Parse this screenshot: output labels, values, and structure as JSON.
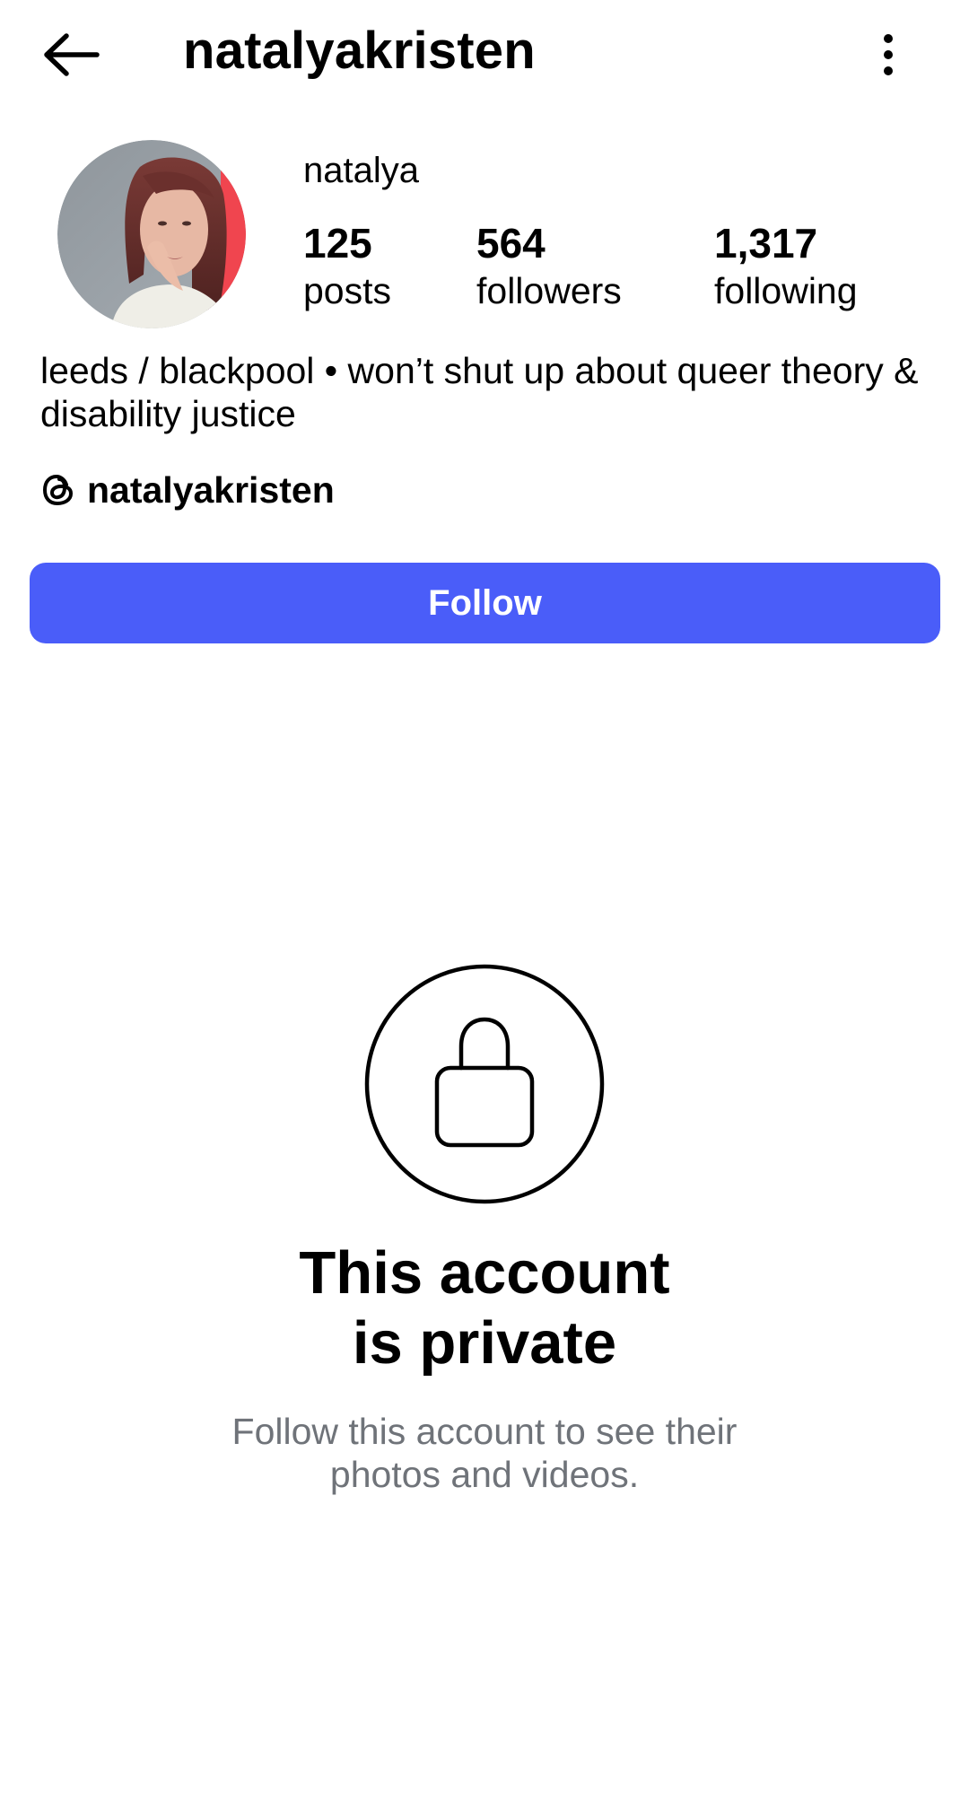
{
  "header": {
    "username": "natalyakristen",
    "back_icon": "arrow-left-icon",
    "more_icon": "more-vertical-icon"
  },
  "profile": {
    "display_name": "natalya",
    "avatar_ring_color": "#f0454f",
    "stats": [
      {
        "value": "125",
        "label": "posts"
      },
      {
        "value": "564",
        "label": "followers"
      },
      {
        "value": "1,317",
        "label": "following"
      }
    ],
    "bio": "leeds / blackpool • won’t shut up about queer theory & disability justice",
    "threads": {
      "icon": "threads-icon",
      "handle": "natalyakristen"
    }
  },
  "actions": {
    "follow_label": "Follow",
    "follow_color": "#4a5df9"
  },
  "private": {
    "icon": "lock-icon",
    "title_line1": "This account",
    "title_line2": "is private",
    "subtitle_line1": "Follow this account to see their",
    "subtitle_line2": "photos and videos."
  }
}
